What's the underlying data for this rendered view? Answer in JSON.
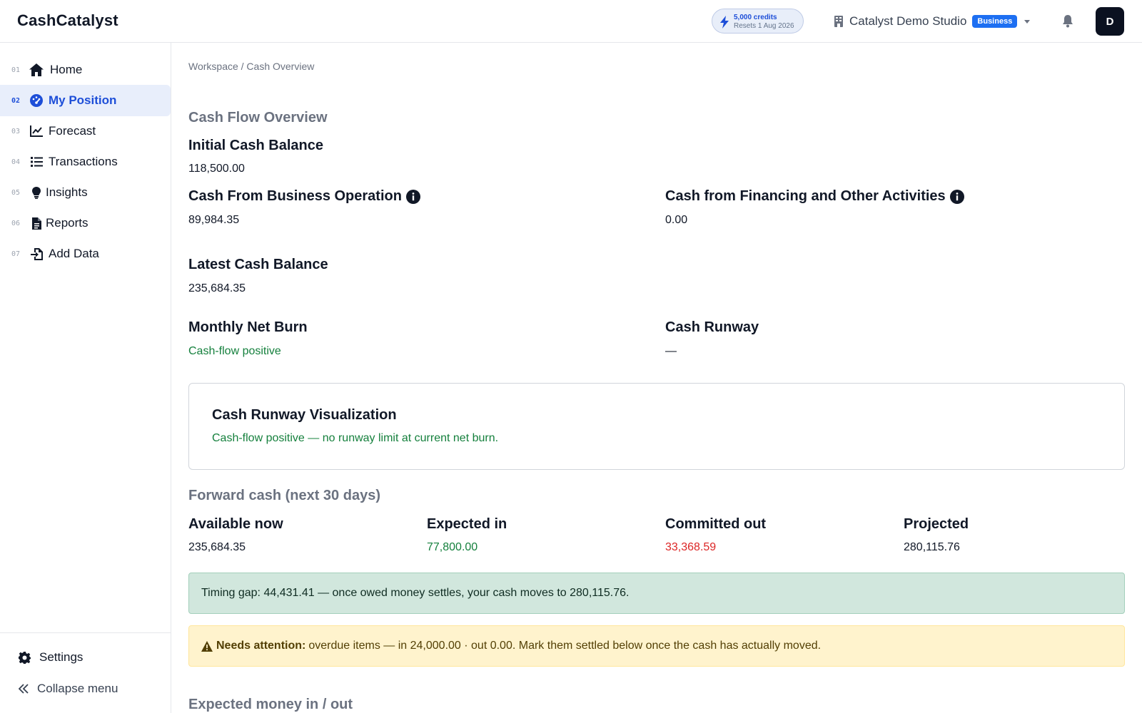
{
  "app": {
    "brand": "CashCatalyst"
  },
  "header": {
    "credits": {
      "amount": "5,000 credits",
      "resets": "Resets 1 Aug 2026",
      "icon": "bolt-icon"
    },
    "org": {
      "name": "Catalyst Demo Studio",
      "plan_badge": "Business"
    },
    "avatar_initial": "D"
  },
  "sidebar": {
    "items": [
      {
        "num": "01",
        "label": "Home",
        "icon": "home-icon"
      },
      {
        "num": "02",
        "label": "My Position",
        "icon": "gauge-icon",
        "active": true
      },
      {
        "num": "03",
        "label": "Forecast",
        "icon": "line-chart-icon"
      },
      {
        "num": "04",
        "label": "Transactions",
        "icon": "list-icon"
      },
      {
        "num": "05",
        "label": "Insights",
        "icon": "lightbulb-icon"
      },
      {
        "num": "06",
        "label": "Reports",
        "icon": "document-icon"
      },
      {
        "num": "07",
        "label": "Add Data",
        "icon": "import-icon"
      }
    ],
    "settings_label": "Settings",
    "collapse_label": "Collapse menu"
  },
  "breadcrumb": "Workspace / Cash Overview",
  "overview": {
    "title": "Cash Flow Overview",
    "initial_label": "Initial Cash Balance",
    "initial_value": "118,500.00",
    "business_label": "Cash From Business Operation",
    "business_value": "89,984.35",
    "financing_label": "Cash from Financing and Other Activities",
    "financing_value": "0.00",
    "latest_label": "Latest Cash Balance",
    "latest_value": "235,684.35",
    "burn_label": "Monthly Net Burn",
    "burn_value": "Cash-flow positive",
    "runway_label": "Cash Runway",
    "runway_value": "—"
  },
  "runway_viz": {
    "title": "Cash Runway Visualization",
    "message": "Cash-flow positive — no runway limit at current net burn."
  },
  "forward": {
    "title": "Forward cash (next 30 days)",
    "available_label": "Available now",
    "available_value": "235,684.35",
    "expected_label": "Expected in",
    "expected_value": "77,800.00",
    "committed_label": "Committed out",
    "committed_value": "33,368.59",
    "projected_label": "Projected",
    "projected_value": "280,115.76"
  },
  "alerts": {
    "timing": "Timing gap: 44,431.41 — once owed money settles, your cash moves to 280,115.76.",
    "attention_title": "Needs attention:",
    "attention_text": "overdue items — in 24,000.00 · out 0.00. Mark them settled below once the cash has actually moved."
  },
  "expected_section": {
    "title": "Expected money in / out"
  },
  "colors": {
    "accent": "#1d4ed8",
    "positive": "#15803d",
    "negative": "#dc2626"
  }
}
